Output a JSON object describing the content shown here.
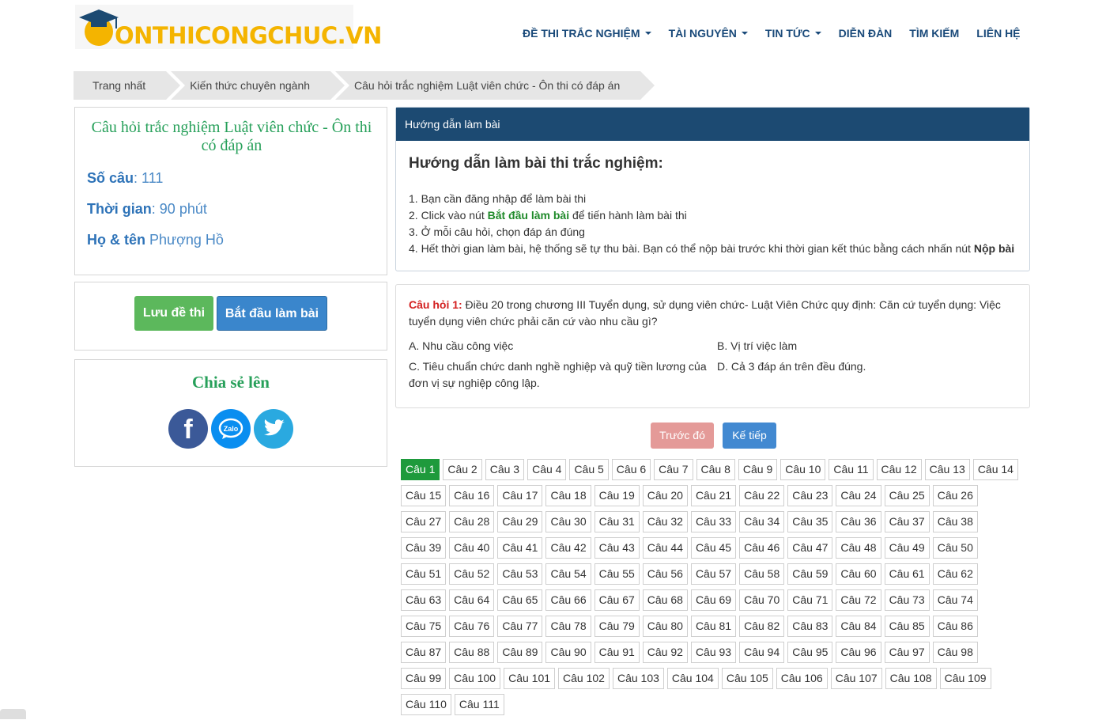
{
  "header": {
    "logo_text": "ONTHICONGCHUC.VN",
    "nav": [
      {
        "label": "ĐỀ THI TRẮC NGHIỆM",
        "dropdown": true
      },
      {
        "label": "TÀI NGUYÊN",
        "dropdown": true
      },
      {
        "label": "TIN TỨC",
        "dropdown": true
      },
      {
        "label": "DIỄN ĐÀN",
        "dropdown": false
      },
      {
        "label": "TÌM KIẾM",
        "dropdown": false
      },
      {
        "label": "LIÊN HỆ",
        "dropdown": false
      }
    ]
  },
  "breadcrumb": [
    "Trang nhất",
    "Kiến thức chuyên ngành",
    "Câu hỏi trắc nghiệm Luật viên chức - Ôn thi có đáp án"
  ],
  "exam": {
    "title": "Câu hỏi trắc nghiệm Luật viên chức - Ôn thi có đáp án",
    "count_label": "Số câu",
    "count_value": ": 111",
    "time_label": "Thời gian",
    "time_value": ": 90 phút",
    "name_label": "Họ & tên",
    "name_value": " Phượng Hồ"
  },
  "buttons": {
    "save": "Lưu đề thi",
    "start": "Bắt đầu làm bài"
  },
  "share": {
    "title": "Chia sẻ lên",
    "icons": [
      "facebook-icon",
      "zalo-icon",
      "twitter-icon"
    ]
  },
  "guide": {
    "header": "Hướng dẫn làm bài",
    "title": "Hướng dẫn làm bài thi trắc nghiệm:",
    "l1": "1. Bạn cần đăng nhập để làm bài thi",
    "l2_pre": "2. Click vào nút ",
    "l2_bold": "Bắt đầu làm bài",
    "l2_post": " để tiến hành làm bài thi",
    "l3": "3. Ở mỗi câu hỏi, chọn đáp án đúng",
    "l4_pre": "4. Hết thời gian làm bài, hệ thống sẽ tự thu bài. Bạn có thể nộp bài trước khi thời gian kết thúc bằng cách nhấn nút ",
    "l4_bold": "Nộp bài"
  },
  "question": {
    "label": "Câu hỏi 1:",
    "text": " Điều 20 trong chương III Tuyển dụng, sử dụng viên chức- Luật Viên Chức quy định: Căn cứ tuyển dụng: Việc tuyển dụng viên chức phải căn cứ vào nhu cầu gì?",
    "a": "A. Nhu cầu công việc",
    "b": "B. Vị trí việc làm",
    "c": "C. Tiêu chuẩn chức danh nghề nghiệp và quỹ tiền lương của đơn vị sự nghiệp công lập.",
    "d": "D. Cả 3 đáp án trên đều đúng."
  },
  "pager": {
    "prev": "Trước đó",
    "next": "Kế tiếp"
  },
  "question_list": {
    "prefix": "Câu",
    "total": 111,
    "active": 1
  },
  "colors": {
    "brand_green": "#27a05a",
    "header_blue": "#1c4a72",
    "active_green": "#1e9a3c"
  }
}
